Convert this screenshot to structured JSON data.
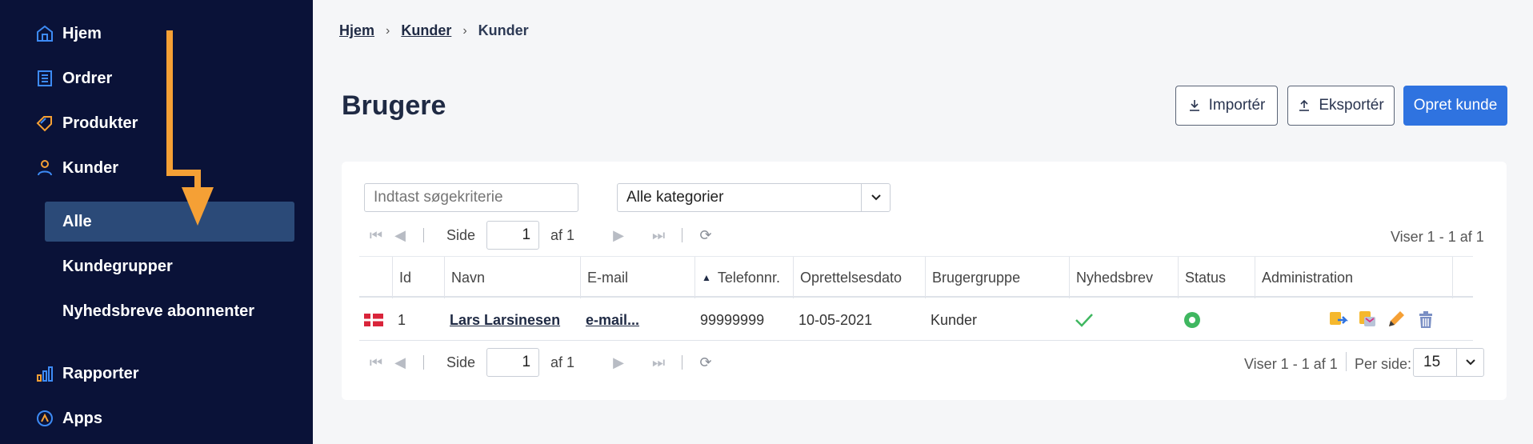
{
  "sidebar": {
    "items": [
      {
        "label": "Hjem",
        "icon": "home-icon"
      },
      {
        "label": "Ordrer",
        "icon": "orders-icon"
      },
      {
        "label": "Produkter",
        "icon": "tag-icon"
      },
      {
        "label": "Kunder",
        "icon": "user-icon"
      }
    ],
    "sub_items": [
      {
        "label": "Alle",
        "active": true
      },
      {
        "label": "Kundegrupper",
        "active": false
      },
      {
        "label": "Nyhedsbreve abonnenter",
        "active": false
      }
    ],
    "bottom_items": [
      {
        "label": "Rapporter",
        "icon": "bar-chart-icon"
      },
      {
        "label": "Apps",
        "icon": "apps-icon"
      }
    ]
  },
  "breadcrumb": {
    "home": "Hjem",
    "section": "Kunder",
    "current": "Kunder"
  },
  "page": {
    "title": "Brugere"
  },
  "toolbar": {
    "import_label": "Importér",
    "export_label": "Eksportér",
    "create_label": "Opret kunde"
  },
  "filters": {
    "search_placeholder": "Indtast søgekriterie",
    "category_value": "Alle kategorier"
  },
  "pager": {
    "page_label": "Side",
    "page_value": "1",
    "of_label": "af 1",
    "info_top": "Viser 1 - 1 af 1",
    "info_bottom": "Viser 1 - 1 af 1",
    "per_page_label": "Per side:",
    "per_page_value": "15"
  },
  "table": {
    "headers": {
      "id": "Id",
      "name": "Navn",
      "email": "E-mail",
      "phone": "Telefonnr.",
      "created": "Oprettelsesdato",
      "group": "Brugergruppe",
      "newsletter": "Nyhedsbrev",
      "status": "Status",
      "admin": "Administration"
    },
    "rows": [
      {
        "id": "1",
        "name": "Lars Larsinesen",
        "email": "e-mail...",
        "phone": "99999999",
        "created": "10-05-2021",
        "group": "Kunder"
      }
    ]
  },
  "colors": {
    "sidebar_bg": "#0a1238",
    "active_bg": "#2b4a78",
    "primary": "#2f73e0",
    "accent_orange": "#f5a035",
    "status_green": "#3fb760"
  }
}
